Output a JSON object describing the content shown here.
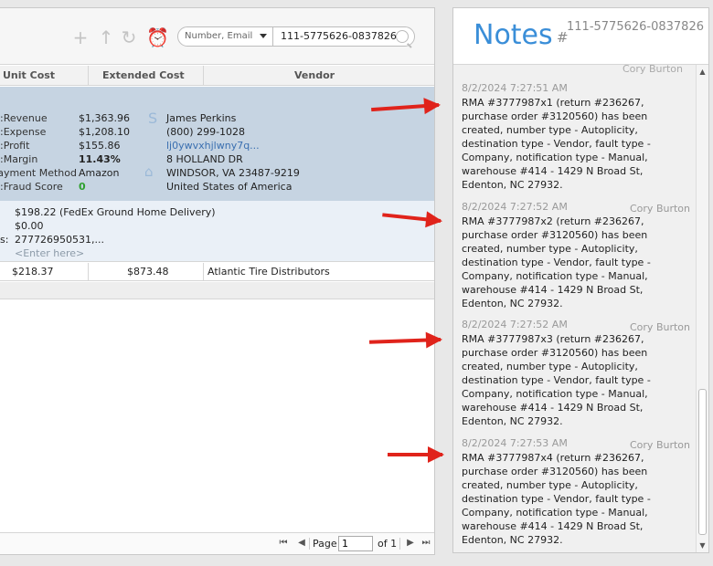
{
  "order": {
    "search": {
      "type_label": "Number, Email",
      "value": "111-5775626-0837826"
    },
    "columns": [
      "Unit Cost",
      "Extended Cost",
      "Vendor"
    ],
    "financials": [
      {
        "label": "Revenue:",
        "value": "$1,363.96",
        "style": ""
      },
      {
        "label": "Expense:",
        "value": "$1,208.10",
        "style": ""
      },
      {
        "label": "Profit:",
        "value": "$155.86",
        "style": ""
      },
      {
        "label": "Margin:",
        "value": "11.43%",
        "style": "bold"
      },
      {
        "label": "Payment Method:",
        "value": "Amazon",
        "style": ""
      },
      {
        "label": "Fraud Score:",
        "value": "0",
        "style": "green"
      }
    ],
    "customer": {
      "name": "James Perkins",
      "phone": "(800) 299-1028",
      "email": "lj0ywvxhjlwny7q...",
      "address1": "8 HOLLAND DR",
      "address2": "WINDSOR, VA 23487-9219",
      "country": "United States of America"
    },
    "shipping": {
      "rate": "$198.22 (FedEx Ground Home Delivery)",
      "cost": "$0.00",
      "tracking_label": "s:",
      "tracking": "277726950531,...",
      "notes_placeholder": "<Enter here>"
    },
    "line_item": {
      "unit_cost": "$218.37",
      "extended_cost": "$873.48",
      "vendor": "Atlantic Tire Distributors"
    },
    "pager": {
      "page_label": "Page",
      "page_value": "1",
      "of_label": "of 1"
    }
  },
  "notes": {
    "title": "Notes",
    "hash": "#",
    "order_id": "111-5775626-0837826",
    "prev_author": "Cory Burton",
    "items": [
      {
        "time": "8/2/2024 7:27:51 AM",
        "text": "RMA #3777987x1 (return #236267, purchase order #3120560) has been created, number type - Autoplicity, destination type - Vendor, fault type - Company, notification type - Manual, warehouse #414 - 1429 N Broad St, Edenton, NC 27932.",
        "author": "Cory Burton"
      },
      {
        "time": "8/2/2024 7:27:52 AM",
        "text": "RMA #3777987x2 (return #236267, purchase order #3120560) has been created, number type - Autoplicity, destination type - Vendor, fault type - Company, notification type - Manual, warehouse #414 - 1429 N Broad St, Edenton, NC 27932.",
        "author": "Cory Burton"
      },
      {
        "time": "8/2/2024 7:27:52 AM",
        "text": "RMA #3777987x3 (return #236267, purchase order #3120560) has been created, number type - Autoplicity, destination type - Vendor, fault type - Company, notification type - Manual, warehouse #414 - 1429 N Broad St, Edenton, NC 27932.",
        "author": "Cory Burton"
      },
      {
        "time": "8/2/2024 7:27:53 AM",
        "text": "RMA #3777987x4 (return #236267, purchase order #3120560) has been created, number type - Autoplicity, destination type - Vendor, fault type - Company, notification type - Manual, warehouse #414 - 1429 N Broad St, Edenton, NC 27932.",
        "author": "Cory Burton"
      }
    ]
  },
  "annotation_color": "#e0231b",
  "accent_color": "#3a8ed8"
}
